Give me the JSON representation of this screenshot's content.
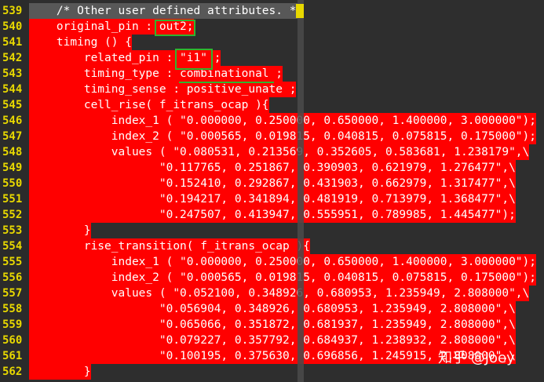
{
  "lines": [
    {
      "num": "539",
      "text": "    /* Other user defined attributes. */",
      "hl": "cur"
    },
    {
      "num": "540",
      "text": "    original_pin : out2;",
      "hl": "hl"
    },
    {
      "num": "541",
      "text": "    timing () {",
      "hl": "hl"
    },
    {
      "num": "542",
      "text": "        related_pin : \"i1\" ;",
      "hl": "hl"
    },
    {
      "num": "543",
      "text": "        timing_type : combinational ;",
      "hl": "hl"
    },
    {
      "num": "544",
      "text": "        timing_sense : positive_unate ;",
      "hl": "hl"
    },
    {
      "num": "545",
      "text": "        cell_rise( f_itrans_ocap ){",
      "hl": "hl"
    },
    {
      "num": "546",
      "text": "            index_1 ( \"0.000000, 0.250000, 0.650000, 1.400000, 3.000000\");",
      "hl": "hl"
    },
    {
      "num": "547",
      "text": "            index_2 ( \"0.000565, 0.019815, 0.040815, 0.075815, 0.175000\");",
      "hl": "hl"
    },
    {
      "num": "548",
      "text": "            values ( \"0.080531, 0.213569, 0.352605, 0.583681, 1.238179\",\\",
      "hl": "hl"
    },
    {
      "num": "549",
      "text": "                   \"0.117765, 0.251867, 0.390903, 0.621979, 1.276477\",\\",
      "hl": "hl"
    },
    {
      "num": "550",
      "text": "                   \"0.152410, 0.292867, 0.431903, 0.662979, 1.317477\",\\",
      "hl": "hl"
    },
    {
      "num": "551",
      "text": "                   \"0.194217, 0.341894, 0.481919, 0.713979, 1.368477\",\\",
      "hl": "hl"
    },
    {
      "num": "552",
      "text": "                   \"0.247507, 0.413947, 0.555951, 0.789985, 1.445477\");",
      "hl": "hl"
    },
    {
      "num": "553",
      "text": "        }",
      "hl": "hl"
    },
    {
      "num": "554",
      "text": "        rise_transition( f_itrans_ocap ){",
      "hl": "hl"
    },
    {
      "num": "555",
      "text": "            index_1 ( \"0.000000, 0.250000, 0.650000, 1.400000, 3.000000\");",
      "hl": "hl"
    },
    {
      "num": "556",
      "text": "            index_2 ( \"0.000565, 0.019815, 0.040815, 0.075815, 0.175000\");",
      "hl": "hl"
    },
    {
      "num": "557",
      "text": "            values ( \"0.052100, 0.348926, 0.680953, 1.235949, 2.808000\",\\",
      "hl": "hl"
    },
    {
      "num": "558",
      "text": "                   \"0.056904, 0.348926, 0.680953, 1.235949, 2.808000\",\\",
      "hl": "hl"
    },
    {
      "num": "559",
      "text": "                   \"0.065066, 0.351872, 0.681937, 1.235949, 2.808000\",\\",
      "hl": "hl"
    },
    {
      "num": "560",
      "text": "                   \"0.079227, 0.357792, 0.684937, 1.238932, 2.808000\",\\",
      "hl": "hl"
    },
    {
      "num": "561",
      "text": "                   \"0.100195, 0.375630, 0.696856, 1.245915, 2.808000\",\\",
      "hl": "hl"
    },
    {
      "num": "562",
      "text": "        }",
      "hl": "hl"
    }
  ],
  "watermark": "知乎 @Joey",
  "colors": {
    "highlight": "#ff0000",
    "line_number": "#e8d800",
    "annotation": "#2fb52f",
    "background": "#2e2e2e"
  }
}
